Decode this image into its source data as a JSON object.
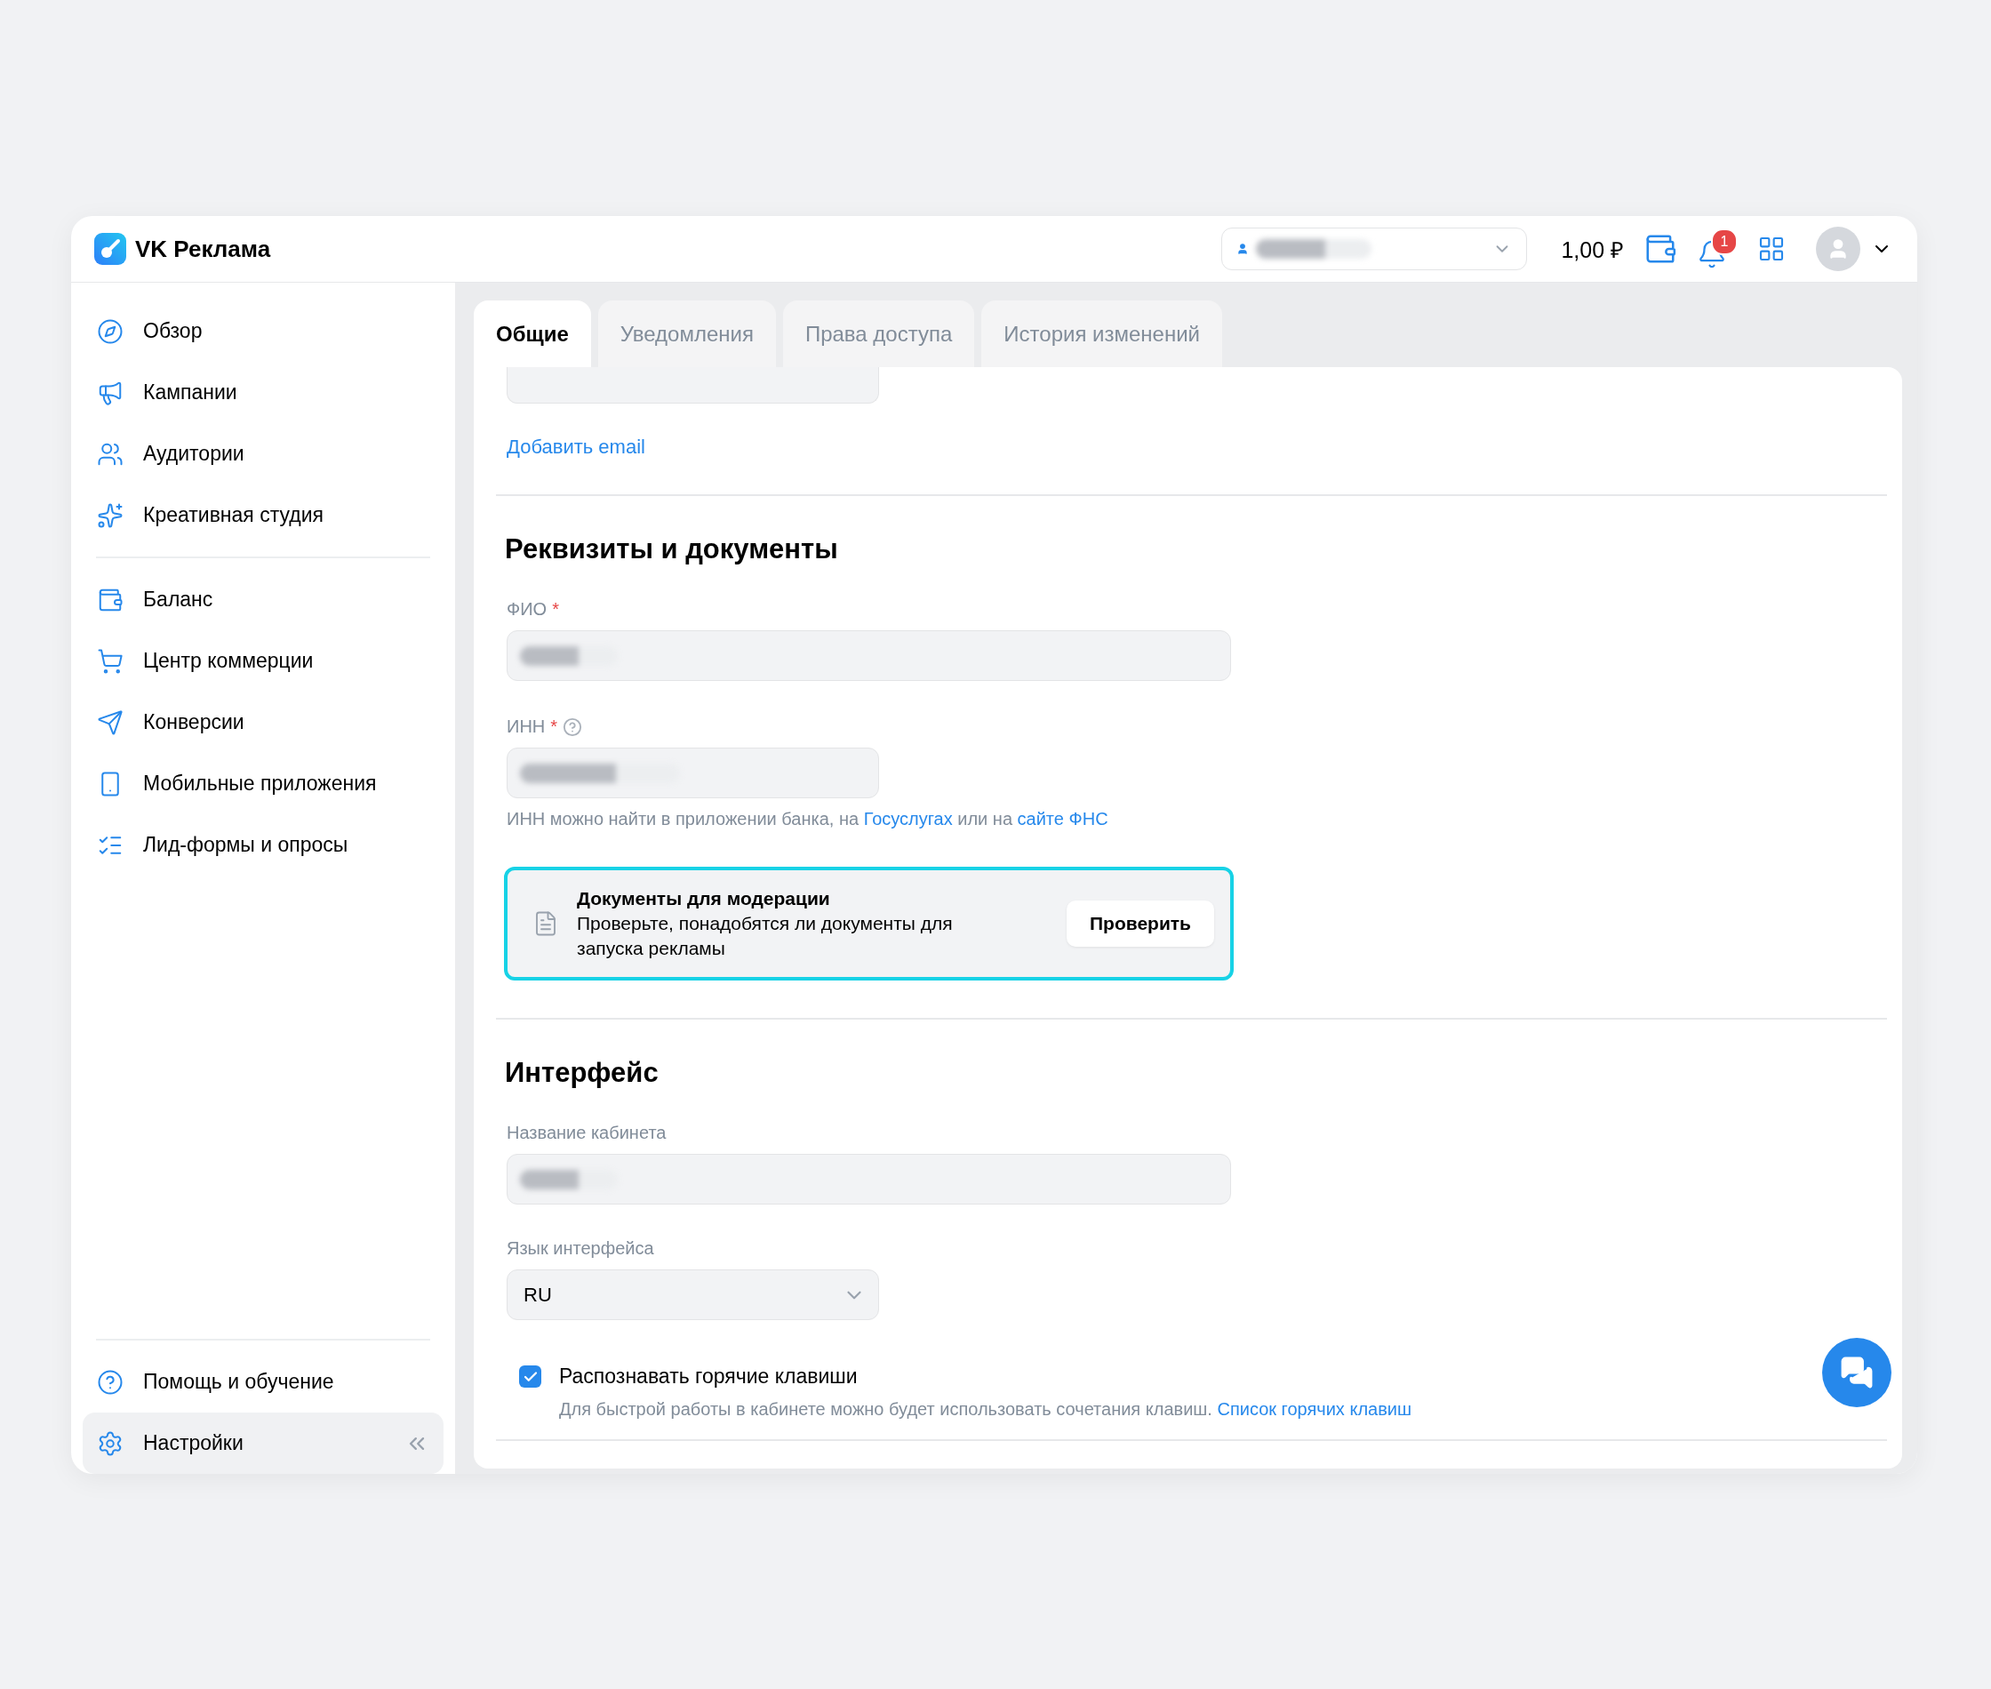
{
  "app": {
    "title": "VK Реклама"
  },
  "header": {
    "balance": "1,00 ₽",
    "notifications_badge": "1"
  },
  "sidebar": {
    "groups": [
      [
        {
          "label": "Обзор",
          "selected": false
        },
        {
          "label": "Кампании",
          "selected": false
        },
        {
          "label": "Аудитории",
          "selected": false
        },
        {
          "label": "Креативная студия",
          "selected": false
        }
      ],
      [
        {
          "label": "Баланс",
          "selected": false
        },
        {
          "label": "Центр коммерции",
          "selected": false
        },
        {
          "label": "Конверсии",
          "selected": false
        },
        {
          "label": "Мобильные приложения",
          "selected": false
        },
        {
          "label": "Лид-формы и опросы",
          "selected": false
        }
      ]
    ],
    "bottom_items": [
      {
        "label": "Помощь и обучение",
        "selected": false
      },
      {
        "label": "Настройки",
        "selected": true
      }
    ]
  },
  "tabs": [
    {
      "label": "Общие",
      "selected": true
    },
    {
      "label": "Уведомления",
      "selected": false
    },
    {
      "label": "Права доступа",
      "selected": false
    },
    {
      "label": "История изменений",
      "selected": false
    }
  ],
  "email": {
    "add_link": "Добавить email"
  },
  "requisites": {
    "title": "Реквизиты и документы",
    "fio": {
      "label": "ФИО",
      "mark": "*"
    },
    "inn": {
      "label": "ИНН",
      "mark": "*"
    },
    "inn_hint": [
      {
        "text": "ИНН можно найти в приложении банка, на ",
        "kind": "text"
      },
      {
        "text": "Госуслугах",
        "kind": "link"
      },
      {
        "text": " или на ",
        "kind": "text"
      },
      {
        "text": "сайте ФНС",
        "kind": "link"
      }
    ],
    "docs": {
      "title": "Документы для модерации",
      "text": "Проверьте, понадобятся ли документы для запуска рекламы",
      "button": "Проверить"
    }
  },
  "interface": {
    "title": "Интерфейс",
    "cabinet_label": "Название кабинета",
    "language": {
      "label": "Язык интерфейса",
      "value": "RU"
    },
    "hotkeys": {
      "label": "Распознавать горячие клавиши",
      "checked": true,
      "hint": [
        {
          "text": "Для быстрой работы в кабинете можно будет использовать сочетания клавиш. ",
          "kind": "text"
        },
        {
          "text": "Список горячих клавиш",
          "kind": "link"
        }
      ]
    }
  }
}
